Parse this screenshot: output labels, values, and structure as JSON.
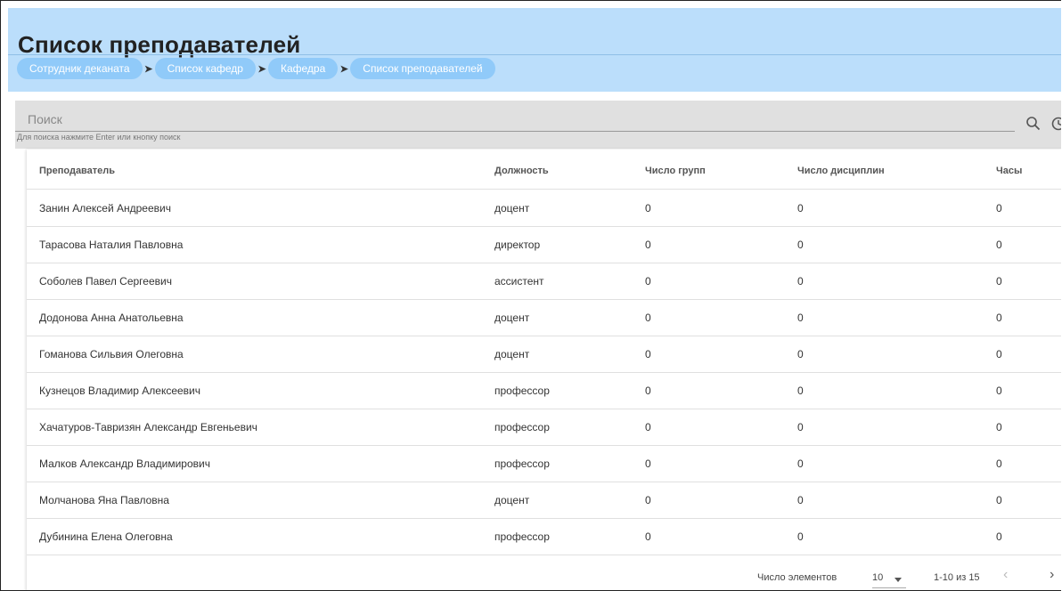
{
  "header": {
    "title": "Список преподавателей",
    "breadcrumb": [
      "Сотрудник деканата",
      "Список кафедр",
      "Кафедра",
      "Список преподавателей"
    ]
  },
  "search": {
    "placeholder": "Поиск",
    "hint": "Для поиска нажмите Enter или кнопку поиск",
    "icon": "search-icon",
    "history_icon": "history-icon"
  },
  "table": {
    "columns": [
      "Преподаватель",
      "Должность",
      "Число групп",
      "Число дисциплин",
      "Часы"
    ],
    "rows": [
      [
        "Занин Алексей Андреевич",
        "доцент",
        "0",
        "0",
        "0"
      ],
      [
        "Тарасова Наталия Павловна",
        "директор",
        "0",
        "0",
        "0"
      ],
      [
        "Соболев Павел Сергеевич",
        "ассистент",
        "0",
        "0",
        "0"
      ],
      [
        "Додонова Анна Анатольевна",
        "доцент",
        "0",
        "0",
        "0"
      ],
      [
        "Гоманова Сильвия Олеговна",
        "доцент",
        "0",
        "0",
        "0"
      ],
      [
        "Кузнецов Владимир Алексеевич",
        "профессор",
        "0",
        "0",
        "0"
      ],
      [
        "Хачатуров-Тавризян Александр Евгеньевич",
        "профессор",
        "0",
        "0",
        "0"
      ],
      [
        "Малков Александр Владимирович",
        "профессор",
        "0",
        "0",
        "0"
      ],
      [
        "Молчанова Яна Павловна",
        "доцент",
        "0",
        "0",
        "0"
      ],
      [
        "Дубинина Елена Олеговна",
        "профессор",
        "0",
        "0",
        "0"
      ]
    ]
  },
  "pagination": {
    "items_label": "Число элементов",
    "page_size": "10",
    "range": "1-10 из 15",
    "prev": "‹",
    "next": "›"
  },
  "colors": {
    "header_bg": "#bbdefb",
    "crumb_bg": "#90caf9",
    "search_bg": "#e0e0e0"
  }
}
